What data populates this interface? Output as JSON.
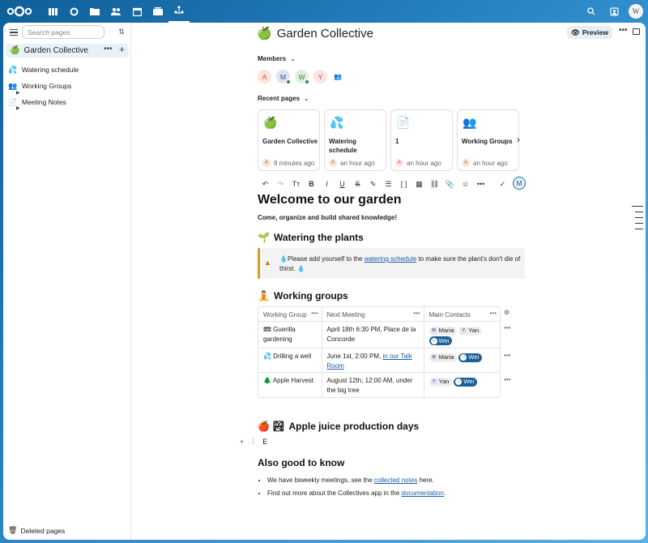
{
  "topbar": {
    "logo": "nextcloud-logo",
    "apps": [
      "dashboard-icon",
      "search-app-icon",
      "files-icon",
      "contacts-icon",
      "calendar-icon",
      "deck-icon",
      "collectives-icon"
    ],
    "user_initial": "W"
  },
  "sidebar": {
    "search_placeholder": "Search pages",
    "collective": {
      "emoji": "🍏",
      "label": "Garden Collective",
      "more": "•••",
      "add": "+"
    },
    "items": [
      {
        "emoji": "💦",
        "label": "Watering schedule"
      },
      {
        "emoji": "👥",
        "label": "Working Groups"
      },
      {
        "emoji": "📄",
        "label": "Meeting Notes"
      }
    ],
    "deleted": "Deleted pages"
  },
  "header": {
    "emoji": "🍏",
    "title": "Garden Collective",
    "preview": "Preview",
    "more": "•••"
  },
  "members": {
    "label": "Members",
    "avatars": [
      {
        "initial": "A",
        "bg": "#fde3d8",
        "fg": "#c4542e",
        "online": false
      },
      {
        "initial": "M",
        "bg": "#dde4f4",
        "fg": "#2b4f8a",
        "online": true
      },
      {
        "initial": "W",
        "bg": "#e0f0e0",
        "fg": "#3a7a3a",
        "online": true
      },
      {
        "initial": "Y",
        "bg": "#fbe4e4",
        "fg": "#c04a4a",
        "online": false
      }
    ]
  },
  "recent": {
    "label": "Recent pages",
    "cards": [
      {
        "emoji": "🍏",
        "title": "Garden Collective",
        "time": "8 minutes ago",
        "initial": "A"
      },
      {
        "emoji": "💦",
        "title": "Watering schedule",
        "time": "an hour ago",
        "initial": "A"
      },
      {
        "emoji": "📄",
        "title": "1",
        "time": "an hour ago",
        "initial": "A"
      },
      {
        "emoji": "👥",
        "title": "Working Groups",
        "time": "an hour ago",
        "initial": "A"
      }
    ]
  },
  "toolbar": {
    "items": [
      "↶",
      "↷",
      "Tт",
      "B",
      "I",
      "U",
      "S",
      "✎",
      "☰",
      "[ ]",
      "▦",
      "⛓",
      "📎",
      "☺",
      "•••"
    ],
    "check": "✓",
    "user": "M"
  },
  "doc": {
    "h1": "Welcome to our garden",
    "subtitle": "Come, organize and build shared knowledge!",
    "h2_water": {
      "emoji": "🌱",
      "text": "Watering the plants"
    },
    "callout": {
      "pre": "💧Please add yourself to the ",
      "link": "watering schedule",
      "post": " to make sure the plant's don't die of thirst. 💧"
    },
    "h2_groups": {
      "emoji": "🧘",
      "text": "Working groups"
    },
    "table": {
      "headers": [
        "Working Group",
        "Next Meeting",
        "Main Contacts"
      ],
      "rows": [
        {
          "group": "📼 Guerilla gardening",
          "meeting": "April 18th 6:30 PM, Place de la Concorde",
          "link": "",
          "contacts": [
            {
              "i": "M",
              "name": "Maria"
            },
            {
              "i": "Y",
              "name": "Yan"
            }
          ],
          "team": "Wei"
        },
        {
          "group": "💦 Drilling a well",
          "meeting": "June 1st, 2:00 PM, ",
          "link": "in our Talk Room",
          "contacts": [
            {
              "i": "M",
              "name": "Maria"
            }
          ],
          "team": "Wei"
        },
        {
          "group": "🌲 Apple Harvest",
          "meeting": "August 12th, 12:00 AM, under the big tree",
          "link": "",
          "contacts": [
            {
              "i": "Y",
              "name": "Yan"
            }
          ],
          "team": "Wei"
        }
      ]
    },
    "h2_juice": {
      "emoji": "🍎 🏞",
      "text": "Apple juice production days"
    },
    "edit_text": "E",
    "h2_also": "Also good to know",
    "bullets": [
      {
        "pre": "We have biweekly meetings, see the ",
        "link": "collected notes",
        "post": " here."
      },
      {
        "pre": "Find out more about the Collectives app in the ",
        "link": "documentation",
        "post": "."
      }
    ]
  }
}
